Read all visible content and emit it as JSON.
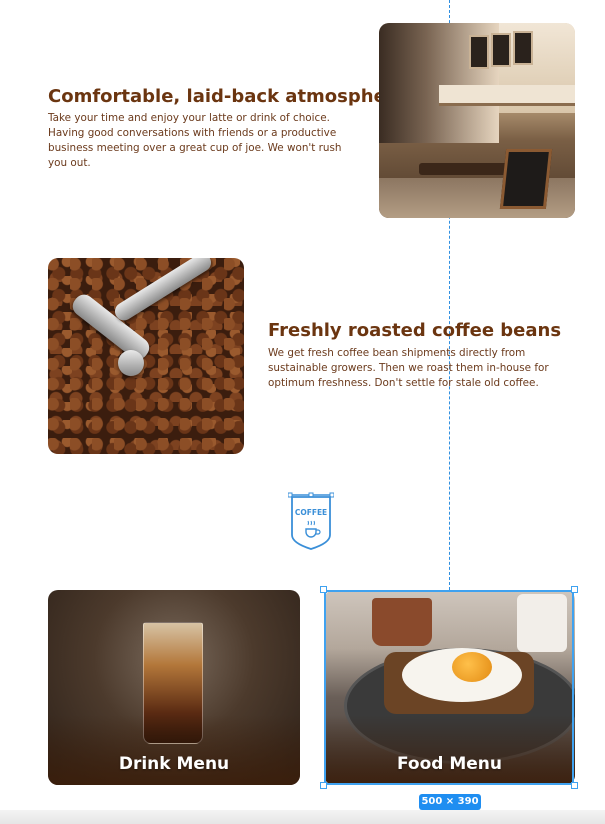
{
  "features": [
    {
      "title": "Comfortable, laid-back atmosphere",
      "text": "Take your time and enjoy your latte or drink of choice. Having good conversations with friends or a productive business meeting over a great cup of joe. We won't rush you out."
    },
    {
      "title": "Freshly roasted coffee beans",
      "text": "We get fresh coffee bean shipments directly from sustainable growers. Then we roast them in-house for optimum freshness. Don't settle for stale old coffee."
    }
  ],
  "badge": {
    "label": "COFFEE"
  },
  "menus": [
    {
      "label": "Drink Menu"
    },
    {
      "label": "Food Menu"
    }
  ],
  "selection": {
    "size_label": "500 × 390"
  },
  "colors": {
    "heading": "#6b3510",
    "body": "#6b3a1c",
    "selection": "#3fa2f0"
  }
}
